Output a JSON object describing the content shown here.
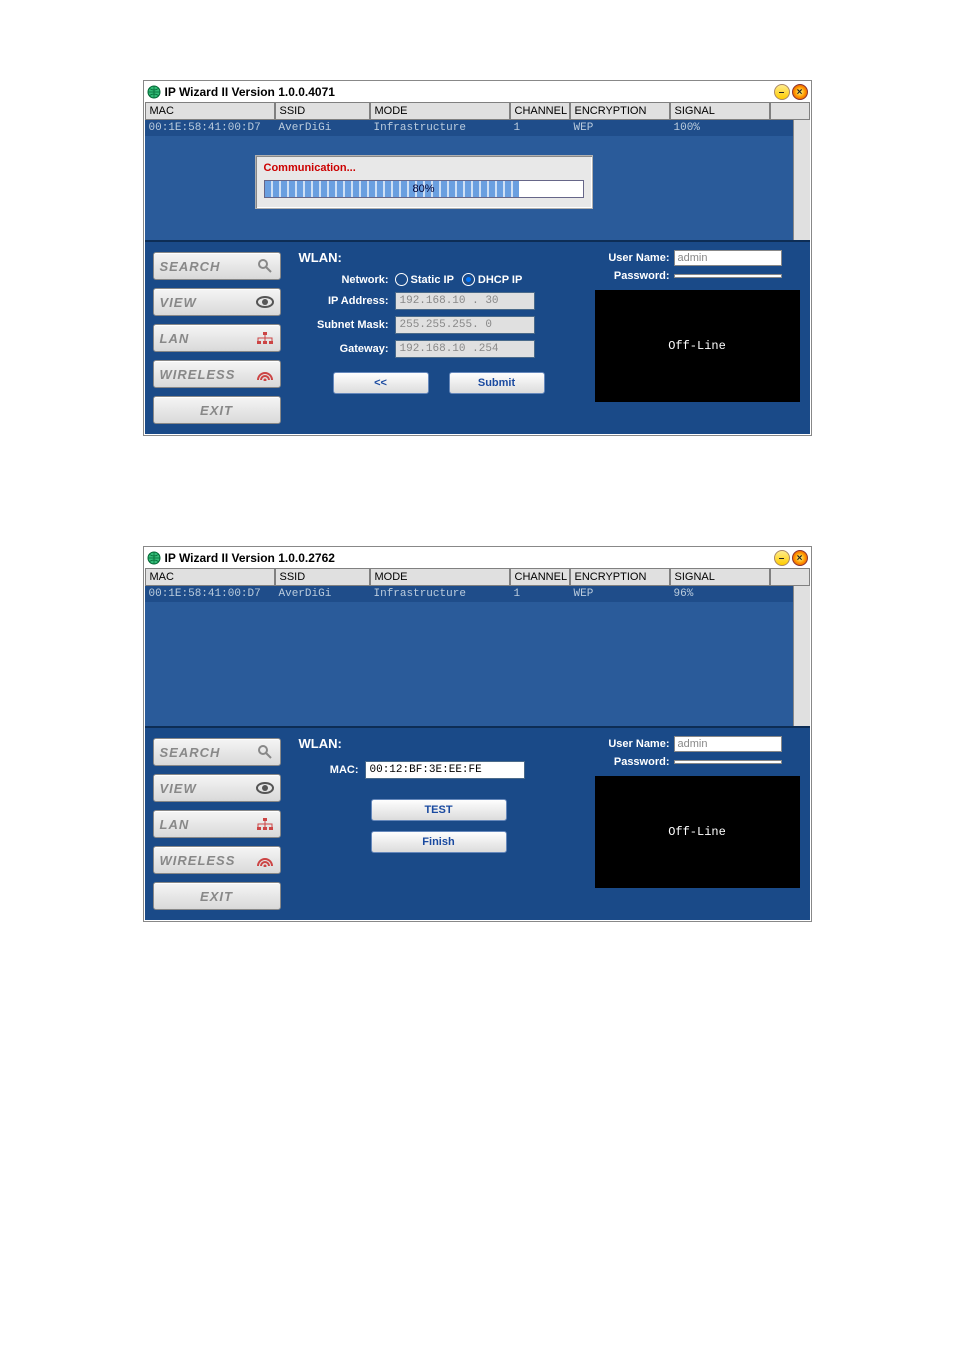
{
  "app1": {
    "title": "IP Wizard II Version 1.0.0.4071",
    "headers": {
      "mac": "MAC",
      "ssid": "SSID",
      "mode": "MODE",
      "channel": "CHANNEL",
      "enc": "ENCRYPTION",
      "signal": "SIGNAL"
    },
    "row": {
      "mac": "00:1E:58:41:00:D7",
      "ssid": "AverDiGi",
      "mode": "Infrastructure",
      "channel": "1",
      "enc": "WEP",
      "signal": "100%"
    },
    "comm": {
      "title": "Communication...",
      "pct_label": "80%",
      "pct": 80
    },
    "sidebar": {
      "search": "SEARCH",
      "view": "VIEW",
      "lan": "LAN",
      "wireless": "WIRELESS",
      "exit": "EXIT"
    },
    "wlan": {
      "title": "WLAN:",
      "network_label": "Network:",
      "static": "Static IP",
      "dhcp": "DHCP IP",
      "ip_label": "IP Address:",
      "ip": "192.168.10 . 30",
      "mask_label": "Subnet Mask:",
      "mask": "255.255.255.  0",
      "gw_label": "Gateway:",
      "gw": "192.168.10 .254",
      "back": "<<",
      "submit": "Submit"
    },
    "creds": {
      "un_label": "User Name:",
      "un": "admin",
      "pw_label": "Password:",
      "pw": ""
    },
    "preview": "Off-Line"
  },
  "app2": {
    "title": "IP Wizard II Version 1.0.0.2762",
    "headers": {
      "mac": "MAC",
      "ssid": "SSID",
      "mode": "MODE",
      "channel": "CHANNEL",
      "enc": "ENCRYPTION",
      "signal": "SIGNAL"
    },
    "row": {
      "mac": "00:1E:58:41:00:D7",
      "ssid": "AverDiGi",
      "mode": "Infrastructure",
      "channel": "1",
      "enc": "WEP",
      "signal": "96%"
    },
    "sidebar": {
      "search": "SEARCH",
      "view": "VIEW",
      "lan": "LAN",
      "wireless": "WIRELESS",
      "exit": "EXIT"
    },
    "wlan": {
      "title": "WLAN:",
      "mac_label": "MAC:",
      "mac": "00:12:BF:3E:EE:FE",
      "test": "TEST",
      "finish": "Finish"
    },
    "creds": {
      "un_label": "User Name:",
      "un": "admin",
      "pw_label": "Password:",
      "pw": ""
    },
    "preview": "Off-Line"
  }
}
